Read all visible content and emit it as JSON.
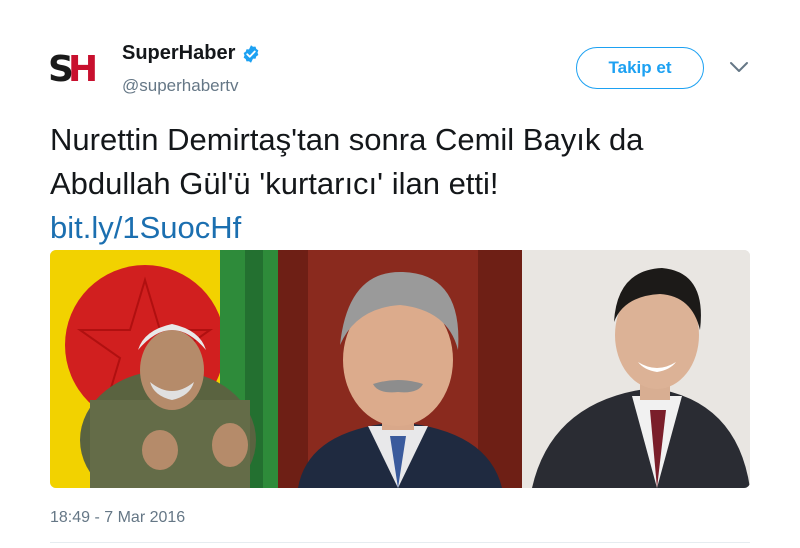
{
  "account": {
    "logo_text_s": "S",
    "logo_text_h": "H",
    "display_name": "SuperHaber",
    "handle": "@superhabertv",
    "verified_icon": "verified-badge-icon"
  },
  "actions": {
    "follow_label": "Takip et",
    "more_icon": "chevron-down-icon"
  },
  "tweet": {
    "text_line1": "Nurettin Demirtaş'tan sonra Cemil Bayık da",
    "text_line2": "Abdullah Gül'ü 'kurtarıcı' ilan etti!",
    "link": "bit.ly/1SuocHf",
    "timestamp": "18:49 - 7 Mar 2016"
  },
  "colors": {
    "accent": "#1da1f2",
    "link": "#1b6fb0",
    "secondary_text": "#657786",
    "logo_red": "#c8102e"
  }
}
